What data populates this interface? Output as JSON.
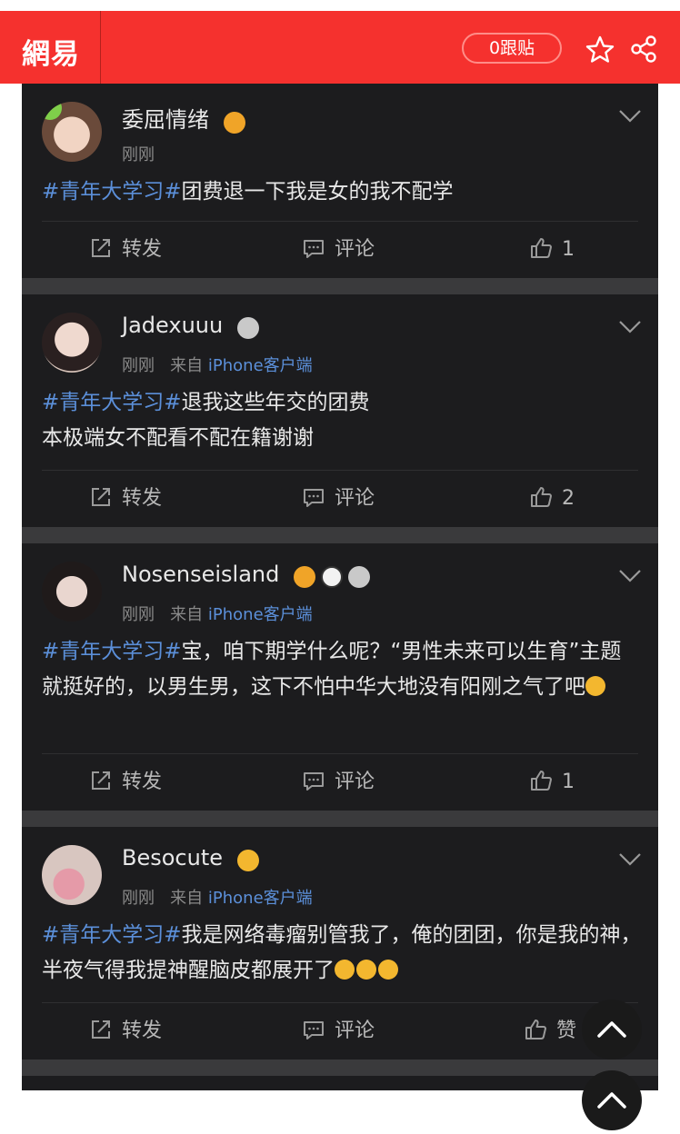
{
  "header": {
    "logo": "網易",
    "follow_label": "0跟贴",
    "bg_color": "#f5312e"
  },
  "posts": [
    {
      "user": "委屈情绪",
      "time": "刚刚",
      "source_prefix": "",
      "source": "",
      "hashtag": "#青年大学习#",
      "text": "团费退一下我是女的我不配学",
      "repost_label": "转发",
      "comment_label": "评论",
      "like_count": "1"
    },
    {
      "user": "Jadexuuu",
      "time": "刚刚",
      "source_prefix": "来自",
      "source": "iPhone客户端",
      "hashtag": "#青年大学习#",
      "text": "退我这些年交的团费\n本极端女不配看不配在籍谢谢",
      "repost_label": "转发",
      "comment_label": "评论",
      "like_count": "2"
    },
    {
      "user": "Nosenseisland",
      "time": "刚刚",
      "source_prefix": "来自",
      "source": "iPhone客户端",
      "hashtag": "#青年大学习#",
      "text": "宝，咱下期学什么呢？“男性未来可以生育”主题就挺好的，以男生男，这下不怕中华大地没有阳刚之气了吧",
      "repost_label": "转发",
      "comment_label": "评论",
      "like_count": "1"
    },
    {
      "user": "Besocute",
      "time": "刚刚",
      "source_prefix": "来自",
      "source": "iPhone客户端",
      "hashtag": "#青年大学习#",
      "text": "我是网络毒瘤别管我了，俺的团团，你是我的神，半夜气得我提神醒脑皮都展开了",
      "repost_label": "转发",
      "comment_label": "评论",
      "like_count": "赞"
    }
  ],
  "icons": {
    "star": "star-icon",
    "share": "share-icon",
    "repost": "repost-icon",
    "comment": "comment-icon",
    "like": "thumbs-up-icon",
    "chevron": "chevron-down-icon",
    "scroll_top": "chevron-up-icon"
  }
}
